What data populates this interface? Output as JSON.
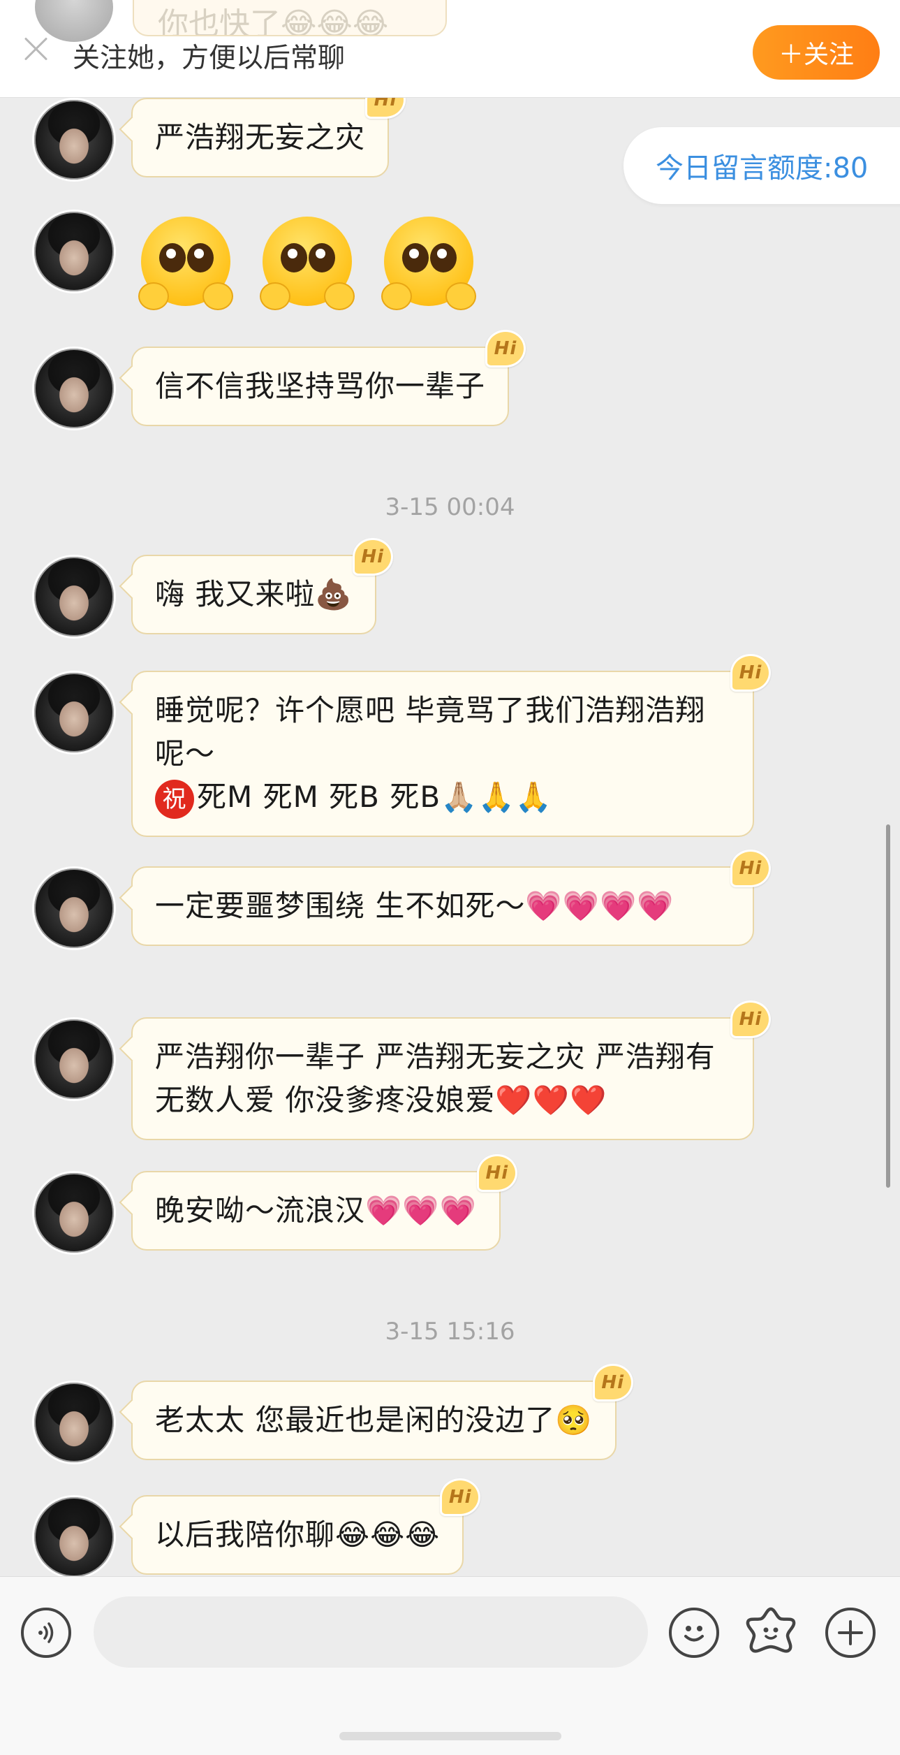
{
  "banner": {
    "peek_text": "你也快了😂😂😂",
    "text": "关注她，方便以后常聊",
    "follow_button": "＋关注"
  },
  "quota": "今日留言额度:80",
  "hi_badge": "Hi",
  "messages": [
    {
      "text": "严浩翔无妄之灾"
    },
    {
      "type": "emoji",
      "emoji_names": [
        "pleading-face",
        "pleading-face",
        "pleading-face"
      ]
    },
    {
      "text": "信不信我坚持骂你一辈子"
    },
    {
      "text": "嗨 我又来啦💩"
    },
    {
      "line1": "睡觉呢？许个愿吧 毕竟骂了我们浩翔浩翔呢～",
      "zhu": "祝",
      "line2": "死M 死M 死B 死B🙏🏼🙏🙏"
    },
    {
      "text": "一定要噩梦围绕 生不如死～💗💗💗💗"
    },
    {
      "text": "严浩翔你一辈子 严浩翔无妄之灾 严浩翔有无数人爱 你没爹疼没娘爱❤️❤️❤️"
    },
    {
      "text": "晚安呦～流浪汉💗💗💗"
    },
    {
      "text": "老太太 您最近也是闲的没边了🥺"
    },
    {
      "text": "以后我陪你聊😂😂😂"
    }
  ],
  "timestamps": [
    "3-15 00:04",
    "3-15 15:16"
  ],
  "input": {
    "placeholder": "",
    "value": ""
  },
  "icons": [
    "close-icon",
    "voice-icon",
    "emoji-icon",
    "sticker-icon",
    "plus-icon"
  ],
  "colors": {
    "accent": "#ff8a1a",
    "quota_text": "#3b8fe0",
    "bubble_bg": "#fffcf1",
    "bubble_border": "#e9d7a8"
  }
}
